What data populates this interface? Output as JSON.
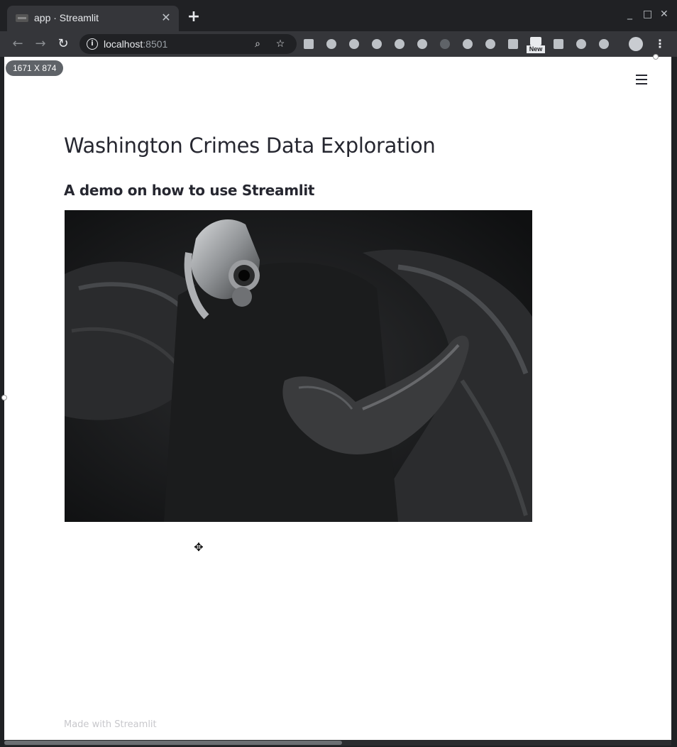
{
  "browser": {
    "tab_title": "app · Streamlit",
    "new_tab": "+",
    "url_host": "localhost",
    "url_port": ":8501",
    "window_controls": [
      "_",
      "□",
      "✕"
    ],
    "extension_new_label": "New"
  },
  "viewport_badge": "1671 X 874",
  "app": {
    "title": "Washington Crimes Data Exploration",
    "subtitle": "A demo on how to use Streamlit",
    "footer": "Made with Streamlit",
    "menu_icon": "hamburger-menu-icon"
  },
  "colors": {
    "chrome_dark": "#202124",
    "chrome_toolbar": "#35363a",
    "page_bg": "#ffffff",
    "text": "#262730",
    "footer_text": "#c8c8cc"
  }
}
